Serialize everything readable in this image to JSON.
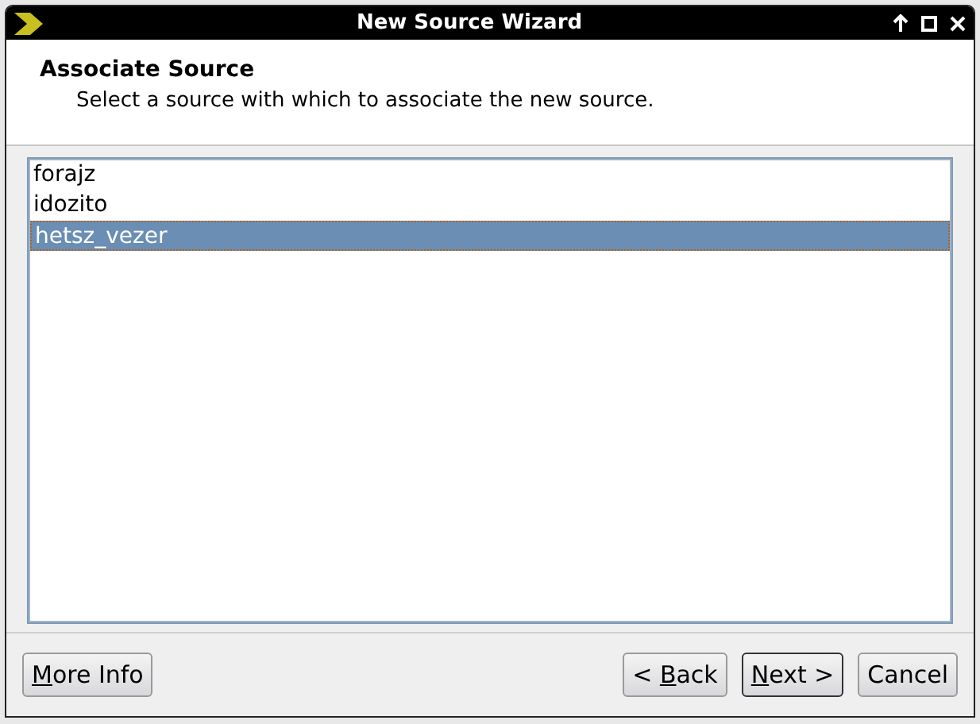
{
  "window": {
    "title": "New Source Wizard"
  },
  "header": {
    "title": "Associate Source",
    "subtitle": "Select a source with which to associate the new source."
  },
  "sources": [
    {
      "label": "forajz",
      "selected": false
    },
    {
      "label": "idozito",
      "selected": false
    },
    {
      "label": "hetsz_vezer",
      "selected": true
    }
  ],
  "buttons": [
    {
      "kind": "left",
      "key": "M",
      "after": "ore Info",
      "default": false
    },
    {
      "kind": "right",
      "before": "< ",
      "key": "B",
      "after": "ack",
      "default": false
    },
    {
      "kind": "right",
      "key": "N",
      "after": "ext >",
      "default": true
    },
    {
      "kind": "right",
      "before": "Cancel",
      "default": false
    }
  ]
}
